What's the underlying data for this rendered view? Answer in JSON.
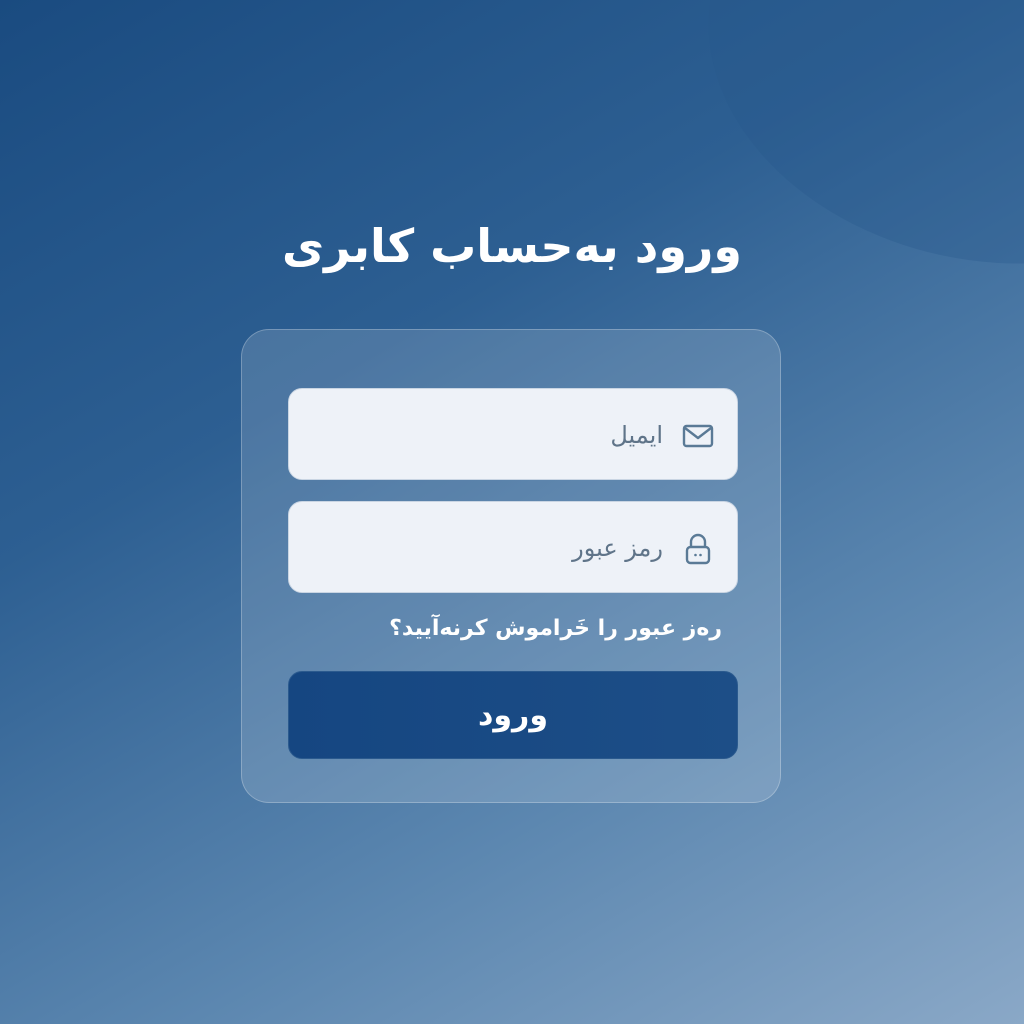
{
  "page": {
    "title": "ورود به‌حساب کابری"
  },
  "form": {
    "email": {
      "placeholder": "ایمیل",
      "value": "",
      "icon": "envelope-icon"
    },
    "password": {
      "placeholder": "رمز عبور",
      "value": "",
      "icon": "lock-icon"
    },
    "forgot_label": "ره‌ز عبور را خَراموش کرنه‌آیید؟",
    "submit_label": "ورود"
  },
  "colors": {
    "background_start": "#1a4b80",
    "background_end": "#8aa8c7",
    "button": "#1a4a84",
    "field_background": "#eef2f8",
    "icon": "#5a7a96"
  }
}
